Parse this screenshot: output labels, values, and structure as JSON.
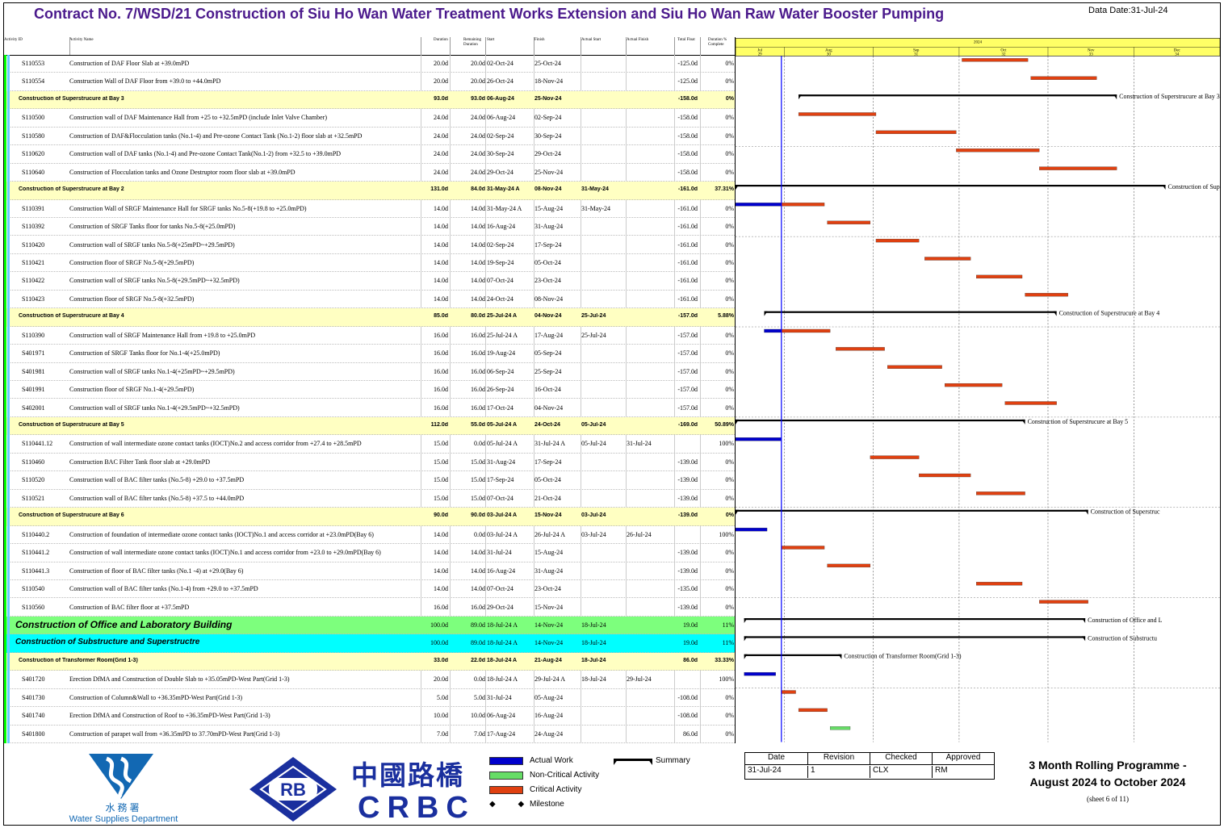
{
  "header": {
    "title": "Contract No. 7/WSD/21 Construction of Siu Ho Wan Water Treatment Works Extension and Siu Ho Wan Raw Water Booster Pumping",
    "data_date": "Data Date:31-Jul-24"
  },
  "columns": [
    "Activity ID",
    "Activity Name",
    "Duration",
    "Remaining Duration",
    "Start",
    "Finish",
    "Actual Start",
    "Actual Finish",
    "Total Float",
    "Duration % Complete"
  ],
  "timescale": {
    "year": "2024",
    "months": [
      {
        "name": "Jul",
        "week": "29"
      },
      {
        "name": "Aug",
        "week": "30"
      },
      {
        "name": "Sep",
        "week": "31"
      },
      {
        "name": "Oct",
        "week": "32"
      },
      {
        "name": "Nov",
        "week": "33"
      },
      {
        "name": "Dec",
        "week": "34"
      }
    ]
  },
  "rows": [
    {
      "type": "act",
      "id": "S110553",
      "name": "Construction of DAF Floor Slab at +39.0mPD",
      "dur": "20.0d",
      "rem": "20.0d",
      "start": "02-Oct-24",
      "finish": "25-Oct-24",
      "as": "",
      "af": "",
      "tf": "-125.0d",
      "pct": "0%"
    },
    {
      "type": "act",
      "id": "S110554",
      "name": "Construction Wall of DAF Floor from +39.0 to +44.0mPD",
      "dur": "20.0d",
      "rem": "20.0d",
      "start": "26-Oct-24",
      "finish": "18-Nov-24",
      "as": "",
      "af": "",
      "tf": "-125.0d",
      "pct": "0%"
    },
    {
      "type": "sum",
      "id": "",
      "name": "Construction of Superstrucure at Bay 3",
      "dur": "93.0d",
      "rem": "93.0d",
      "start": "06-Aug-24",
      "finish": "25-Nov-24",
      "as": "",
      "af": "",
      "tf": "-158.0d",
      "pct": "0%"
    },
    {
      "type": "act",
      "id": "S110500",
      "name": "Construction wall of DAF Maintenance Hall from +25 to +32.5mPD (include Inlet Valve Chamber)",
      "dur": "24.0d",
      "rem": "24.0d",
      "start": "06-Aug-24",
      "finish": "02-Sep-24",
      "as": "",
      "af": "",
      "tf": "-158.0d",
      "pct": "0%"
    },
    {
      "type": "act",
      "id": "S110580",
      "name": "Construction of DAF&Flocculation tanks (No.1-4) and Pre-ozone Contact Tank (No.1-2)  floor slab at +32.5mPD",
      "dur": "24.0d",
      "rem": "24.0d",
      "start": "02-Sep-24",
      "finish": "30-Sep-24",
      "as": "",
      "af": "",
      "tf": "-158.0d",
      "pct": "0%"
    },
    {
      "type": "act",
      "id": "S110620",
      "name": "Construction wall of DAF tanks (No.1-4) and Pre-ozone Contact Tank(No.1-2) from +32.5 to +39.0mPD",
      "dur": "24.0d",
      "rem": "24.0d",
      "start": "30-Sep-24",
      "finish": "29-Oct-24",
      "as": "",
      "af": "",
      "tf": "-158.0d",
      "pct": "0%"
    },
    {
      "type": "act",
      "id": "S110640",
      "name": "Construction of Flocculation tanks and Ozone Destruptor room floor slab at +39.0mPD",
      "dur": "24.0d",
      "rem": "24.0d",
      "start": "29-Oct-24",
      "finish": "25-Nov-24",
      "as": "",
      "af": "",
      "tf": "-158.0d",
      "pct": "0%"
    },
    {
      "type": "sum",
      "id": "",
      "name": "Construction of Superstrucure at Bay 2",
      "dur": "131.0d",
      "rem": "84.0d",
      "start": "31-May-24 A",
      "finish": "08-Nov-24",
      "as": "31-May-24",
      "af": "",
      "tf": "-161.0d",
      "pct": "37.31%"
    },
    {
      "type": "act",
      "id": "S110391",
      "name": "Construction Wall of SRGF Maintenance Hall for SRGF tanks No.5-8(+19.8 to +25.0mPD)",
      "dur": "14.0d",
      "rem": "14.0d",
      "start": "31-May-24 A",
      "finish": "15-Aug-24",
      "as": "31-May-24",
      "af": "",
      "tf": "-161.0d",
      "pct": "0%"
    },
    {
      "type": "act",
      "id": "S110392",
      "name": "Construction of SRGF Tanks floor for tanks No.5-8(+25.0mPD)",
      "dur": "14.0d",
      "rem": "14.0d",
      "start": "16-Aug-24",
      "finish": "31-Aug-24",
      "as": "",
      "af": "",
      "tf": "-161.0d",
      "pct": "0%"
    },
    {
      "type": "act",
      "id": "S110420",
      "name": "Construction wall of SRGF tanks No.5-8(+25mPD~+29.5mPD)",
      "dur": "14.0d",
      "rem": "14.0d",
      "start": "02-Sep-24",
      "finish": "17-Sep-24",
      "as": "",
      "af": "",
      "tf": "-161.0d",
      "pct": "0%"
    },
    {
      "type": "act",
      "id": "S110421",
      "name": "Construction floor of SRGF No.5-8(+29.5mPD)",
      "dur": "14.0d",
      "rem": "14.0d",
      "start": "19-Sep-24",
      "finish": "05-Oct-24",
      "as": "",
      "af": "",
      "tf": "-161.0d",
      "pct": "0%"
    },
    {
      "type": "act",
      "id": "S110422",
      "name": "Construction wall of SRGF tanks No.5-8(+29.5mPD~+32.5mPD)",
      "dur": "14.0d",
      "rem": "14.0d",
      "start": "07-Oct-24",
      "finish": "23-Oct-24",
      "as": "",
      "af": "",
      "tf": "-161.0d",
      "pct": "0%"
    },
    {
      "type": "act",
      "id": "S110423",
      "name": "Construction floor of SRGF No.5-8(+32.5mPD)",
      "dur": "14.0d",
      "rem": "14.0d",
      "start": "24-Oct-24",
      "finish": "08-Nov-24",
      "as": "",
      "af": "",
      "tf": "-161.0d",
      "pct": "0%"
    },
    {
      "type": "sum",
      "id": "",
      "name": "Construction of Superstrucure at Bay 4",
      "dur": "85.0d",
      "rem": "80.0d",
      "start": "25-Jul-24 A",
      "finish": "04-Nov-24",
      "as": "25-Jul-24",
      "af": "",
      "tf": "-157.0d",
      "pct": "5.88%"
    },
    {
      "type": "act",
      "id": "S110390",
      "name": "Construction wall of SRGF Maintenance Hall from +19.8 to +25.0mPD",
      "dur": "16.0d",
      "rem": "16.0d",
      "start": "25-Jul-24 A",
      "finish": "17-Aug-24",
      "as": "25-Jul-24",
      "af": "",
      "tf": "-157.0d",
      "pct": "0%"
    },
    {
      "type": "act",
      "id": "S401971",
      "name": "Construction of SRGF Tanks floor for No.1-4(+25.0mPD)",
      "dur": "16.0d",
      "rem": "16.0d",
      "start": "19-Aug-24",
      "finish": "05-Sep-24",
      "as": "",
      "af": "",
      "tf": "-157.0d",
      "pct": "0%"
    },
    {
      "type": "act",
      "id": "S401981",
      "name": "Construction wall of SRGF tanks No.1-4(+25mPD~+29.5mPD)",
      "dur": "16.0d",
      "rem": "16.0d",
      "start": "06-Sep-24",
      "finish": "25-Sep-24",
      "as": "",
      "af": "",
      "tf": "-157.0d",
      "pct": "0%"
    },
    {
      "type": "act",
      "id": "S401991",
      "name": "Construction floor of SRGF No.1-4(+29.5mPD)",
      "dur": "16.0d",
      "rem": "16.0d",
      "start": "26-Sep-24",
      "finish": "16-Oct-24",
      "as": "",
      "af": "",
      "tf": "-157.0d",
      "pct": "0%"
    },
    {
      "type": "act",
      "id": "S402001",
      "name": "Construction wall of SRGF tanks No.1-4(+29.5mPD~+32.5mPD)",
      "dur": "16.0d",
      "rem": "16.0d",
      "start": "17-Oct-24",
      "finish": "04-Nov-24",
      "as": "",
      "af": "",
      "tf": "-157.0d",
      "pct": "0%"
    },
    {
      "type": "sum",
      "id": "",
      "name": "Construction of Superstrucure at Bay 5",
      "dur": "112.0d",
      "rem": "55.0d",
      "start": "05-Jul-24 A",
      "finish": "24-Oct-24",
      "as": "05-Jul-24",
      "af": "",
      "tf": "-169.0d",
      "pct": "50.89%"
    },
    {
      "type": "act",
      "id": "S110441.12",
      "name": "Construction of wall intermediate ozone contact tanks (IOCT)No.2 and access corridor from +27.4 to +28.5mPD",
      "dur": "15.0d",
      "rem": "0.0d",
      "start": "05-Jul-24 A",
      "finish": "31-Jul-24 A",
      "as": "05-Jul-24",
      "af": "31-Jul-24",
      "tf": "",
      "pct": "100%"
    },
    {
      "type": "act",
      "id": "S110460",
      "name": "Construction BAC Filter Tank floor slab at +29.0mPD",
      "dur": "15.0d",
      "rem": "15.0d",
      "start": "31-Aug-24",
      "finish": "17-Sep-24",
      "as": "",
      "af": "",
      "tf": "-139.0d",
      "pct": "0%"
    },
    {
      "type": "act",
      "id": "S110520",
      "name": "Construction wall of BAC filter tanks (No.5-8) +29.0 to +37.5mPD",
      "dur": "15.0d",
      "rem": "15.0d",
      "start": "17-Sep-24",
      "finish": "05-Oct-24",
      "as": "",
      "af": "",
      "tf": "-139.0d",
      "pct": "0%"
    },
    {
      "type": "act",
      "id": "S110521",
      "name": "Construction wall of BAC filter tanks (No.5-8) +37.5 to +44.0mPD",
      "dur": "15.0d",
      "rem": "15.0d",
      "start": "07-Oct-24",
      "finish": "21-Oct-24",
      "as": "",
      "af": "",
      "tf": "-139.0d",
      "pct": "0%"
    },
    {
      "type": "sum",
      "id": "",
      "name": "Construction of Superstrucure at Bay 6",
      "dur": "90.0d",
      "rem": "90.0d",
      "start": "03-Jul-24 A",
      "finish": "15-Nov-24",
      "as": "03-Jul-24",
      "af": "",
      "tf": "-139.0d",
      "pct": "0%"
    },
    {
      "type": "act",
      "id": "S110440.2",
      "name": "Construction of foundation of intermediate ozone contact tanks (IOCT)No.1 and access corridor at +23.0mPD(Bay 6)",
      "dur": "14.0d",
      "rem": "0.0d",
      "start": "03-Jul-24 A",
      "finish": "26-Jul-24 A",
      "as": "03-Jul-24",
      "af": "26-Jul-24",
      "tf": "",
      "pct": "100%"
    },
    {
      "type": "act",
      "id": "S110441.2",
      "name": "Construction of wall intermediate ozone contact tanks (IOCT)No.1 and access corridor from +23.0 to +29.0mPD(Bay 6)",
      "dur": "14.0d",
      "rem": "14.0d",
      "start": "31-Jul-24",
      "finish": "15-Aug-24",
      "as": "",
      "af": "",
      "tf": "-139.0d",
      "pct": "0%"
    },
    {
      "type": "act",
      "id": "S110441.3",
      "name": "Construction of floor of BAC filter tanks (No.1 -4) at +29.0(Bay 6)",
      "dur": "14.0d",
      "rem": "14.0d",
      "start": "16-Aug-24",
      "finish": "31-Aug-24",
      "as": "",
      "af": "",
      "tf": "-139.0d",
      "pct": "0%"
    },
    {
      "type": "act",
      "id": "S110540",
      "name": "Construction wall of BAC filter tanks (No.1-4) from +29.0 to +37.5mPD",
      "dur": "14.0d",
      "rem": "14.0d",
      "start": "07-Oct-24",
      "finish": "23-Oct-24",
      "as": "",
      "af": "",
      "tf": "-135.0d",
      "pct": "0%"
    },
    {
      "type": "act",
      "id": "S110560",
      "name": "Construction of BAC filter floor at +37.5mPD",
      "dur": "16.0d",
      "rem": "16.0d",
      "start": "29-Oct-24",
      "finish": "15-Nov-24",
      "as": "",
      "af": "",
      "tf": "-139.0d",
      "pct": "0%"
    },
    {
      "type": "wbs1",
      "id": "",
      "name": "Construction of Office and Laboratory Building",
      "dur": "100.0d",
      "rem": "89.0d",
      "start": "18-Jul-24 A",
      "finish": "14-Nov-24",
      "as": "18-Jul-24",
      "af": "",
      "tf": "19.0d",
      "pct": "11%"
    },
    {
      "type": "wbs2",
      "id": "",
      "name": "Construction of Substructure and Superstructre",
      "dur": "100.0d",
      "rem": "89.0d",
      "start": "18-Jul-24 A",
      "finish": "14-Nov-24",
      "as": "18-Jul-24",
      "af": "",
      "tf": "19.0d",
      "pct": "11%"
    },
    {
      "type": "sum",
      "id": "",
      "name": "Construction of Transformer Room(Grid 1-3)",
      "dur": "33.0d",
      "rem": "22.0d",
      "start": "18-Jul-24 A",
      "finish": "21-Aug-24",
      "as": "18-Jul-24",
      "af": "",
      "tf": "86.0d",
      "pct": "33.33%"
    },
    {
      "type": "act",
      "id": "S401720",
      "name": "Erection DfMA and Construction of Double Slab to +35.05mPD-West Part(Grid 1-3)",
      "dur": "20.0d",
      "rem": "0.0d",
      "start": "18-Jul-24 A",
      "finish": "29-Jul-24 A",
      "as": "18-Jul-24",
      "af": "29-Jul-24",
      "tf": "",
      "pct": "100%"
    },
    {
      "type": "act",
      "id": "S401730",
      "name": "Construction of Column&Wall to +36.35mPD-West Part(Grid 1-3)",
      "dur": "5.0d",
      "rem": "5.0d",
      "start": "31-Jul-24",
      "finish": "05-Aug-24",
      "as": "",
      "af": "",
      "tf": "-108.0d",
      "pct": "0%"
    },
    {
      "type": "act",
      "id": "S401740",
      "name": "Erection DfMA and Construction of Roof to +36.35mPD-West Part(Grid 1-3)",
      "dur": "10.0d",
      "rem": "10.0d",
      "start": "06-Aug-24",
      "finish": "16-Aug-24",
      "as": "",
      "af": "",
      "tf": "-108.0d",
      "pct": "0%"
    },
    {
      "type": "act",
      "id": "S401800",
      "name": "Construction of parapet wall from +36.35mPD to 37.70mPD-West Part(Grid 1-3)",
      "dur": "7.0d",
      "rem": "7.0d",
      "start": "17-Aug-24",
      "finish": "24-Aug-24",
      "as": "",
      "af": "",
      "tf": "86.0d",
      "pct": "0%"
    }
  ],
  "chart_data": {
    "type": "gantt",
    "data_date": "2024-07-31",
    "x_range": [
      "2024-07-15",
      "2024-12-31"
    ],
    "bars": [
      {
        "row": 0,
        "kind": "critical",
        "start": "2024-10-02",
        "end": "2024-10-25"
      },
      {
        "row": 1,
        "kind": "critical",
        "start": "2024-10-26",
        "end": "2024-11-18"
      },
      {
        "row": 2,
        "kind": "summary",
        "start": "2024-08-06",
        "end": "2024-11-25",
        "label": "Construction of Superstrucure at Bay 3"
      },
      {
        "row": 3,
        "kind": "critical",
        "start": "2024-08-06",
        "end": "2024-09-02"
      },
      {
        "row": 4,
        "kind": "critical",
        "start": "2024-09-02",
        "end": "2024-09-30"
      },
      {
        "row": 5,
        "kind": "critical",
        "start": "2024-09-30",
        "end": "2024-10-29"
      },
      {
        "row": 6,
        "kind": "critical",
        "start": "2024-10-29",
        "end": "2024-11-25"
      },
      {
        "row": 7,
        "kind": "summary",
        "start": "2024-05-31",
        "end": "2024-12-12",
        "label": "Construction of Superstrucure at Bay 2"
      },
      {
        "row": 8,
        "kind": "actual",
        "start": "2024-05-31",
        "end": "2024-07-31"
      },
      {
        "row": 8,
        "kind": "critical",
        "start": "2024-07-31",
        "end": "2024-08-15"
      },
      {
        "row": 9,
        "kind": "critical",
        "start": "2024-08-16",
        "end": "2024-08-31"
      },
      {
        "row": 10,
        "kind": "critical",
        "start": "2024-09-02",
        "end": "2024-09-17"
      },
      {
        "row": 11,
        "kind": "critical",
        "start": "2024-09-19",
        "end": "2024-10-05"
      },
      {
        "row": 12,
        "kind": "critical",
        "start": "2024-10-07",
        "end": "2024-10-23"
      },
      {
        "row": 13,
        "kind": "critical",
        "start": "2024-10-24",
        "end": "2024-11-08"
      },
      {
        "row": 14,
        "kind": "summary",
        "start": "2024-07-25",
        "end": "2024-11-04",
        "label": "Construction of Superstrucure at Bay 4"
      },
      {
        "row": 15,
        "kind": "actual",
        "start": "2024-07-25",
        "end": "2024-07-31"
      },
      {
        "row": 15,
        "kind": "critical",
        "start": "2024-07-31",
        "end": "2024-08-17"
      },
      {
        "row": 16,
        "kind": "critical",
        "start": "2024-08-19",
        "end": "2024-09-05"
      },
      {
        "row": 17,
        "kind": "critical",
        "start": "2024-09-06",
        "end": "2024-09-25"
      },
      {
        "row": 18,
        "kind": "critical",
        "start": "2024-09-26",
        "end": "2024-10-16"
      },
      {
        "row": 19,
        "kind": "critical",
        "start": "2024-10-17",
        "end": "2024-11-04"
      },
      {
        "row": 20,
        "kind": "summary",
        "start": "2024-07-05",
        "end": "2024-10-24",
        "label": "Construction of Superstrucure at Bay 5"
      },
      {
        "row": 21,
        "kind": "actual",
        "start": "2024-07-05",
        "end": "2024-07-31"
      },
      {
        "row": 22,
        "kind": "critical",
        "start": "2024-08-31",
        "end": "2024-09-17"
      },
      {
        "row": 23,
        "kind": "critical",
        "start": "2024-09-17",
        "end": "2024-10-05"
      },
      {
        "row": 24,
        "kind": "critical",
        "start": "2024-10-07",
        "end": "2024-10-24"
      },
      {
        "row": 25,
        "kind": "summary",
        "start": "2024-07-03",
        "end": "2024-11-15",
        "label": "Construction of Superstruc"
      },
      {
        "row": 26,
        "kind": "actual",
        "start": "2024-07-03",
        "end": "2024-07-26"
      },
      {
        "row": 27,
        "kind": "critical",
        "start": "2024-07-31",
        "end": "2024-08-15"
      },
      {
        "row": 28,
        "kind": "critical",
        "start": "2024-08-16",
        "end": "2024-08-31"
      },
      {
        "row": 29,
        "kind": "critical",
        "start": "2024-10-07",
        "end": "2024-10-23"
      },
      {
        "row": 30,
        "kind": "critical",
        "start": "2024-10-29",
        "end": "2024-11-15"
      },
      {
        "row": 31,
        "kind": "summary",
        "start": "2024-07-18",
        "end": "2024-11-14",
        "label": "Construction of Office and L"
      },
      {
        "row": 32,
        "kind": "summary",
        "start": "2024-07-18",
        "end": "2024-11-14",
        "label": "Construction of Substructu"
      },
      {
        "row": 33,
        "kind": "summary",
        "start": "2024-07-18",
        "end": "2024-08-21",
        "label": "Construction of Transformer Room(Grid 1-3)"
      },
      {
        "row": 34,
        "kind": "actual",
        "start": "2024-07-18",
        "end": "2024-07-29"
      },
      {
        "row": 35,
        "kind": "critical",
        "start": "2024-07-31",
        "end": "2024-08-05"
      },
      {
        "row": 36,
        "kind": "critical",
        "start": "2024-08-06",
        "end": "2024-08-16"
      },
      {
        "row": 37,
        "kind": "noncritical",
        "start": "2024-08-17",
        "end": "2024-08-24"
      }
    ]
  },
  "legend": {
    "actual": "Actual Work",
    "noncritical": "Non-Critical Activity",
    "critical": "Critical Activity",
    "milestone": "Milestone",
    "summary": "Summary"
  },
  "colors": {
    "actual": "#0000cc",
    "critical": "#e04010",
    "noncritical": "#66dd66",
    "summary": "#000000",
    "dataline": "#0000ff"
  },
  "revision": {
    "headers": [
      "Date",
      "Revision",
      "Checked",
      "Approved"
    ],
    "values": [
      "31-Jul-24",
      "1",
      "CLX",
      "RM"
    ]
  },
  "footer": {
    "program_title": "3 Month Rolling Programme -",
    "program_range": "August 2024 to October 2024",
    "sheet": "(sheet 6 of 11)",
    "wsd_cn": "水務署",
    "wsd_en": "Water Supplies Department",
    "rb": "RB",
    "crbc_cn": "中國路橋",
    "crbc_en": "CRBC"
  }
}
